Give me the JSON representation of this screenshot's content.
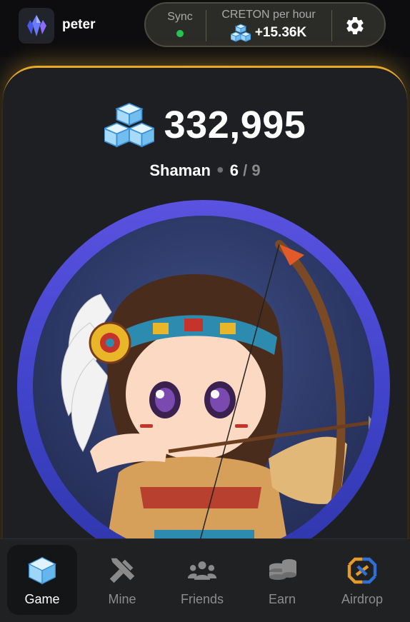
{
  "header": {
    "username": "peter",
    "avatar_icon": "crystal-icon",
    "sync_label": "Sync",
    "sync_status_color": "#23c552",
    "rate_label": "CRETON per hour",
    "rate_value": "+15.36K",
    "settings_icon": "gear-icon"
  },
  "balance": {
    "icon": "ice-cubes-icon",
    "value": "332,995"
  },
  "rank": {
    "title": "Shaman",
    "current_level": "6",
    "separator": "/",
    "max_level": "9"
  },
  "character": {
    "icon": "archer-character"
  },
  "nav": {
    "items": [
      {
        "label": "Game",
        "icon": "ice-cube-icon",
        "active": true
      },
      {
        "label": "Mine",
        "icon": "pickaxe-icon",
        "active": false
      },
      {
        "label": "Friends",
        "icon": "friends-icon",
        "active": false
      },
      {
        "label": "Earn",
        "icon": "coins-icon",
        "active": false
      },
      {
        "label": "Airdrop",
        "icon": "airdrop-icon",
        "active": false
      }
    ]
  },
  "colors": {
    "accent_glow": "#e8a92a",
    "ring": "#4f4ad6",
    "background": "#1d1f22"
  }
}
